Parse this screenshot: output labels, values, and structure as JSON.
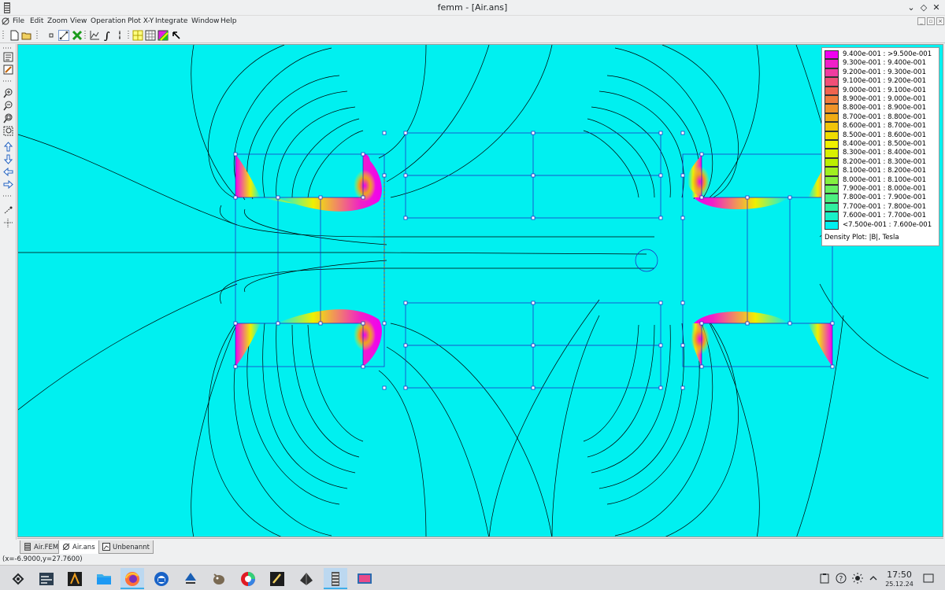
{
  "window": {
    "title": "femm - [Air.ans]"
  },
  "menu": [
    "File",
    "Edit",
    "Zoom",
    "View",
    "Operation",
    "Plot X-Y",
    "Integrate",
    "Window",
    "Help"
  ],
  "toolbar": [
    "new-file-icon",
    "open-folder-icon",
    "point-mode-icon",
    "contour-mode-icon",
    "area-mode-icon",
    "plot-xy-icon",
    "integrate-icon",
    "show-mesh-icon",
    "show-grid-icon",
    "snap-grid-icon",
    "density-plot-icon",
    "pointer-icon"
  ],
  "left_toolbar": [
    "properties-icon",
    "edit-props-icon",
    "zoom-in-icon",
    "zoom-out-icon",
    "zoom-window-icon",
    "zoom-natural-icon",
    "arrow-up-icon",
    "arrow-down-icon",
    "arrow-left-icon",
    "arrow-right-icon",
    "snap-icon",
    "mesh-icon"
  ],
  "legend": {
    "entries": [
      {
        "label": "9.400e-001 : >9.500e-001",
        "color": "#f000f0"
      },
      {
        "label": "9.300e-001 : 9.400e-001",
        "color": "#f020c8"
      },
      {
        "label": "9.200e-001 : 9.300e-001",
        "color": "#f03ca0"
      },
      {
        "label": "9.100e-001 : 9.200e-001",
        "color": "#f05078"
      },
      {
        "label": "9.000e-001 : 9.100e-001",
        "color": "#f06450"
      },
      {
        "label": "8.900e-001 : 9.000e-001",
        "color": "#f07c3c"
      },
      {
        "label": "8.800e-001 : 8.900e-001",
        "color": "#f09428"
      },
      {
        "label": "8.700e-001 : 8.800e-001",
        "color": "#f0ac14"
      },
      {
        "label": "8.600e-001 : 8.700e-001",
        "color": "#f0c40a"
      },
      {
        "label": "8.500e-001 : 8.600e-001",
        "color": "#f0dc00"
      },
      {
        "label": "8.400e-001 : 8.500e-001",
        "color": "#f0f000"
      },
      {
        "label": "8.300e-001 : 8.400e-001",
        "color": "#d8f000"
      },
      {
        "label": "8.200e-001 : 8.300e-001",
        "color": "#bcf000"
      },
      {
        "label": "8.100e-001 : 8.200e-001",
        "color": "#a0f020"
      },
      {
        "label": "8.000e-001 : 8.100e-001",
        "color": "#84f040"
      },
      {
        "label": "7.900e-001 : 8.000e-001",
        "color": "#68f060"
      },
      {
        "label": "7.800e-001 : 7.900e-001",
        "color": "#4cf080"
      },
      {
        "label": "7.700e-001 : 7.800e-001",
        "color": "#30f0a0"
      },
      {
        "label": "7.600e-001 : 7.700e-001",
        "color": "#18f0c8"
      },
      {
        "label": "<7.500e-001 : 7.600e-001",
        "color": "#00f0f0"
      }
    ],
    "caption": "Density Plot: |B|, Tesla"
  },
  "tabs": [
    {
      "label": "Air.FEM",
      "active": false
    },
    {
      "label": "Air.ans",
      "active": true
    },
    {
      "label": "Unbenannt",
      "active": false
    }
  ],
  "status": {
    "coords": "(x=-6.9000,y=27.7600)"
  },
  "taskbar": {
    "apps": [
      "kde-launcher-icon",
      "system-monitor-icon",
      "kate-editor-icon",
      "file-manager-icon",
      "firefox-icon",
      "thunderbird-icon",
      "inkscape-icon",
      "gimp-icon",
      "color-picker-icon",
      "krita-icon",
      "draw-icon",
      "femm-icon",
      "screen-capture-icon"
    ],
    "tray": [
      "clipboard-icon",
      "help-icon",
      "brightness-icon",
      "tray-arrow-icon",
      "show-desktop-icon"
    ],
    "time": "17:50",
    "date": "25.12.24"
  },
  "colors": {
    "background": "#00f0f0",
    "contour": "#000000",
    "geometry": "#2020c0"
  }
}
